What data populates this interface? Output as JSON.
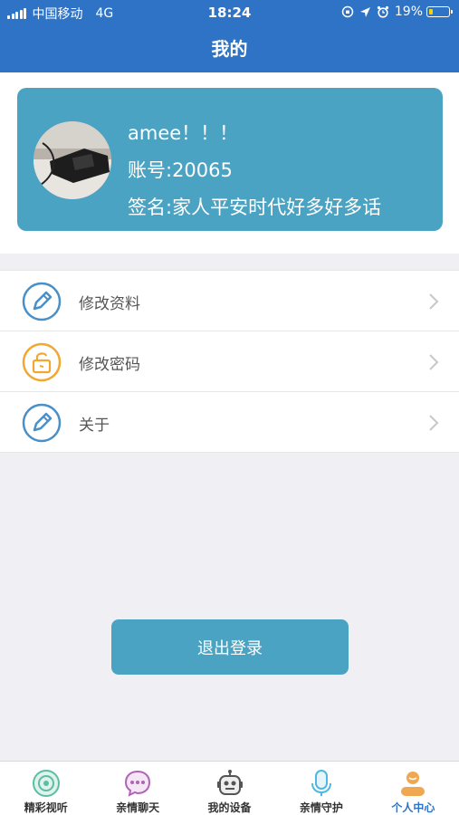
{
  "status_bar": {
    "carrier": "中国移动",
    "network": "4G",
    "time": "18:24",
    "battery": "19%",
    "battery_level": 0.19
  },
  "header": {
    "title": "我的"
  },
  "profile": {
    "name": "amee！！！",
    "account": "账号:20065",
    "signature": "签名:家人平安时代好多好多话"
  },
  "menu": {
    "items": [
      {
        "label": "修改资料",
        "icon": "pencil-icon",
        "color": "#4a90c8"
      },
      {
        "label": "修改密码",
        "icon": "lock-icon",
        "color": "#f0a830"
      },
      {
        "label": "关于",
        "icon": "pencil-icon",
        "color": "#4a90c8"
      }
    ]
  },
  "logout": {
    "label": "退出登录"
  },
  "tabbar": {
    "tabs": [
      {
        "label": "精彩视听",
        "icon": "media-icon"
      },
      {
        "label": "亲情聊天",
        "icon": "chat-icon"
      },
      {
        "label": "我的设备",
        "icon": "robot-icon"
      },
      {
        "label": "亲情守护",
        "icon": "microphone-icon"
      },
      {
        "label": "个人中心",
        "icon": "person-icon",
        "active": true
      }
    ]
  },
  "colors": {
    "primary": "#2e73c5",
    "card": "#4ba3c3",
    "accent_orange": "#f0a830"
  }
}
